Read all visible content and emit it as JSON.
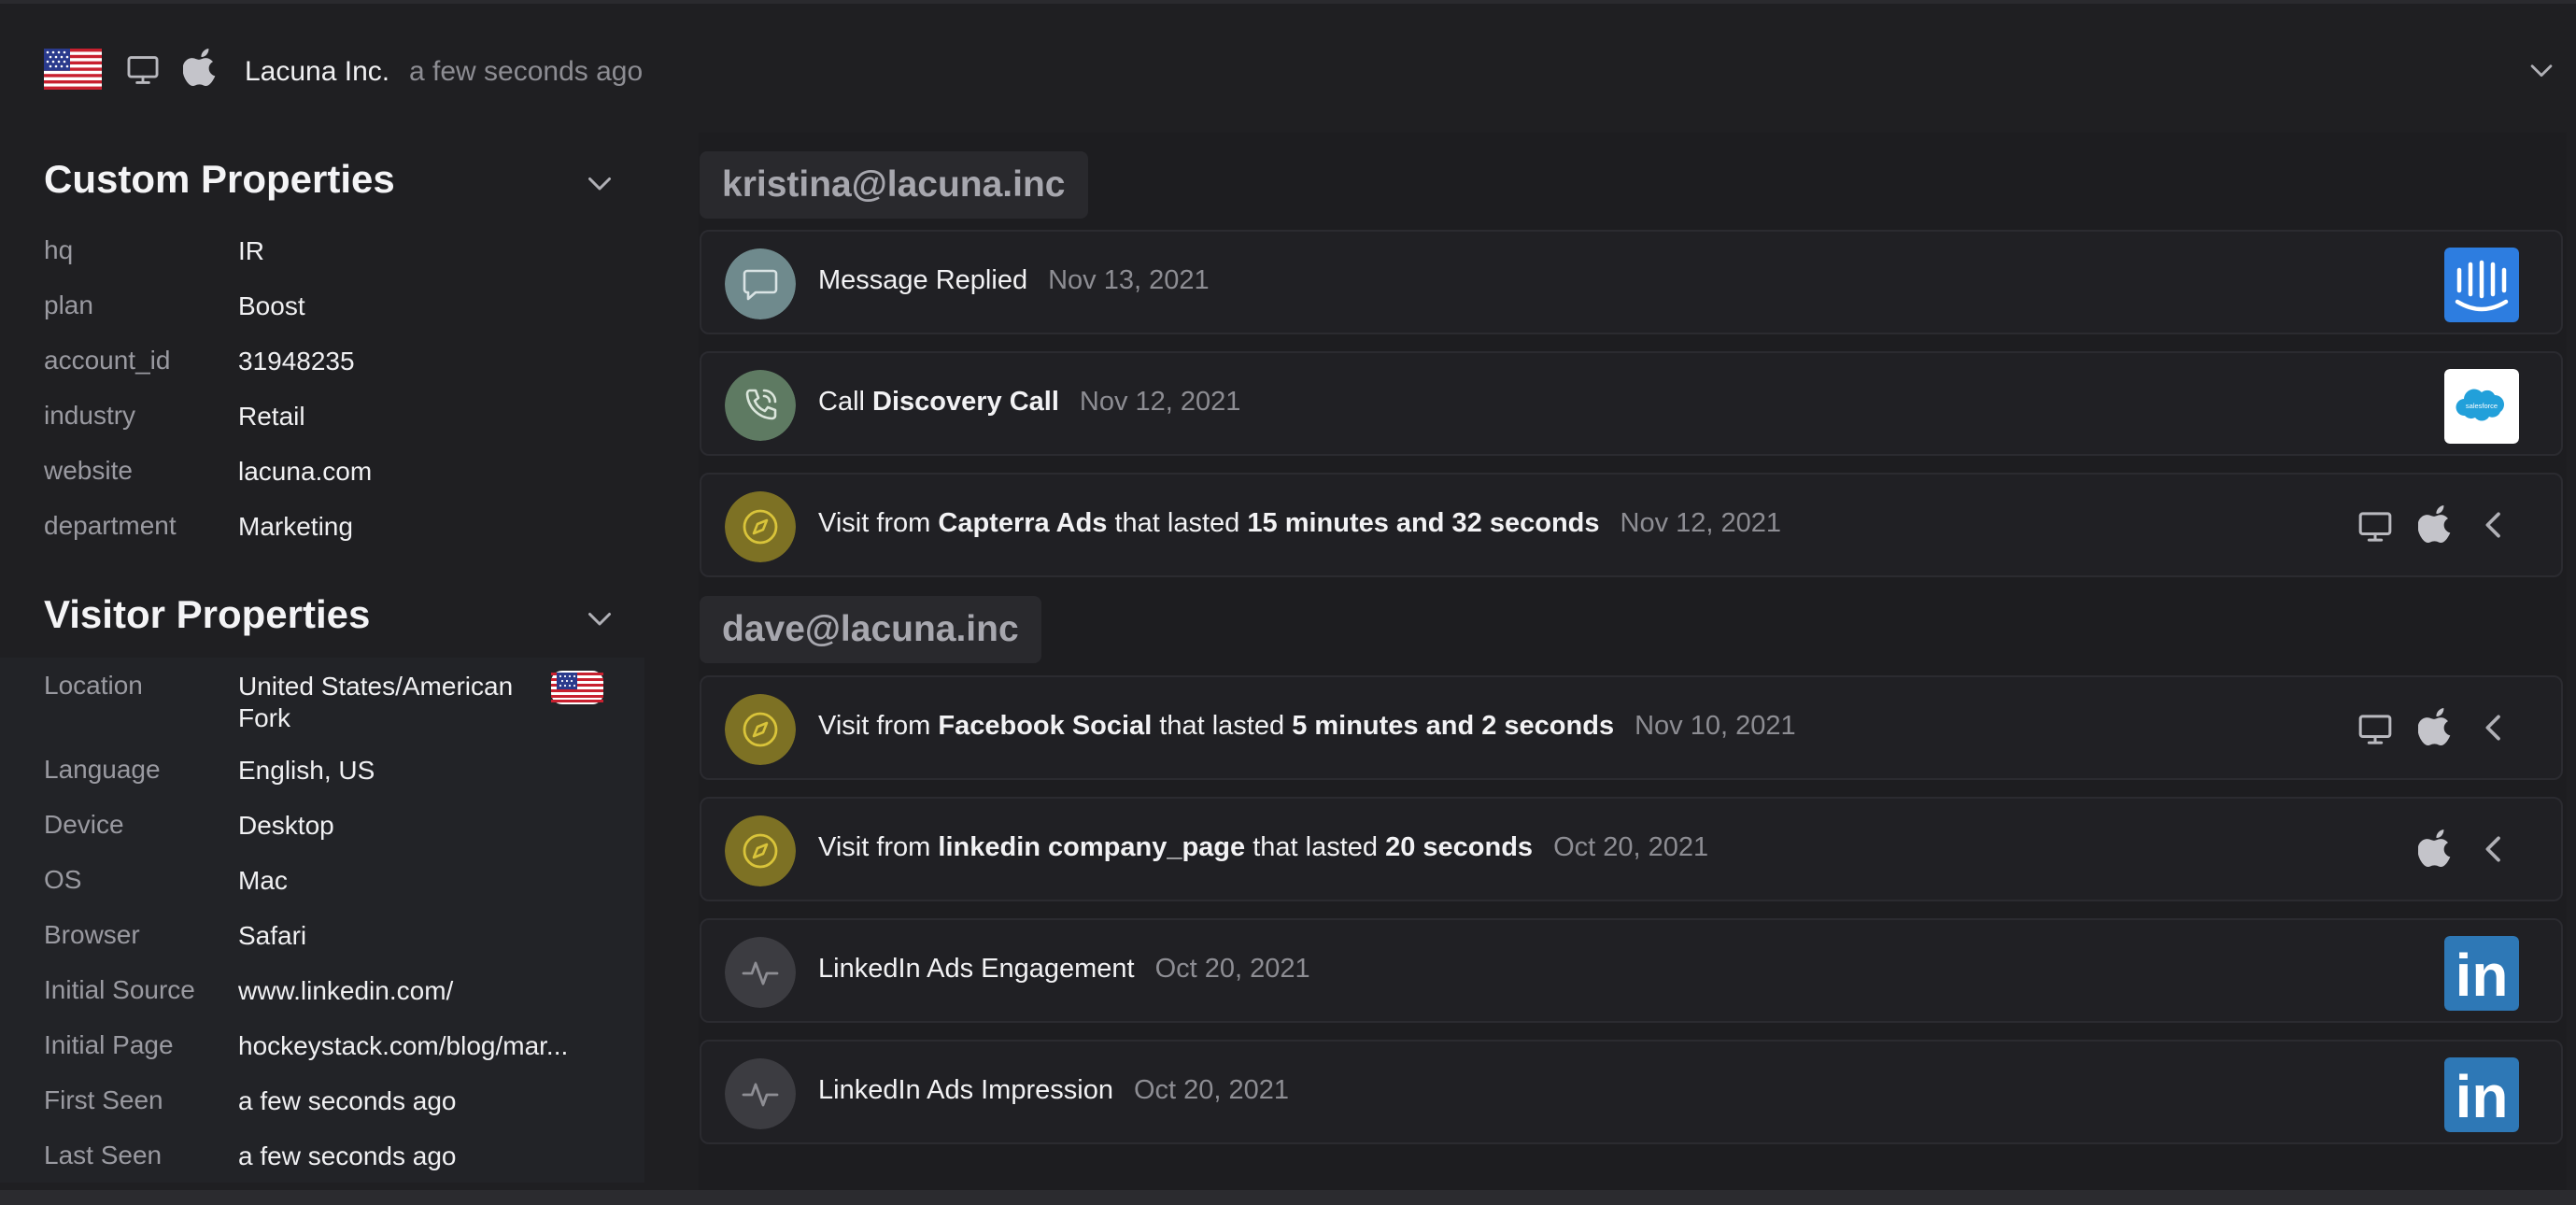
{
  "header": {
    "company": "Lacuna Inc.",
    "time": "a few seconds ago"
  },
  "custom_properties": {
    "title": "Custom Properties",
    "rows": [
      {
        "key": "hq",
        "value": "IR"
      },
      {
        "key": "plan",
        "value": "Boost"
      },
      {
        "key": "account_id",
        "value": "31948235"
      },
      {
        "key": "industry",
        "value": "Retail"
      },
      {
        "key": "website",
        "value": "lacuna.com"
      },
      {
        "key": "department",
        "value": "Marketing"
      }
    ]
  },
  "visitor_properties": {
    "title": "Visitor Properties",
    "location_key": "Location",
    "location_line1": "United States/American",
    "location_line2": "Fork",
    "rows": [
      {
        "key": "Language",
        "value": "English, US"
      },
      {
        "key": "Device",
        "value": "Desktop"
      },
      {
        "key": "OS",
        "value": "Mac"
      },
      {
        "key": "Browser",
        "value": "Safari"
      },
      {
        "key": "Initial Source",
        "value": "www.linkedin.com/"
      },
      {
        "key": "Initial Page",
        "value": "hockeystack.com/blog/mar..."
      },
      {
        "key": "First Seen",
        "value": "a few seconds ago"
      },
      {
        "key": "Last Seen",
        "value": "a few seconds ago"
      }
    ]
  },
  "timeline": {
    "groups": [
      {
        "email": "kristina@lacuna.inc",
        "events": [
          {
            "type": "message",
            "text": "Message Replied",
            "date": "Nov 13, 2021",
            "logo": "intercom"
          },
          {
            "type": "call",
            "prefix": "Call ",
            "bold": "Discovery Call",
            "date": "Nov 12, 2021",
            "logo": "salesforce"
          },
          {
            "type": "visit",
            "prefix": "Visit from ",
            "source": "Capterra Ads",
            "middle": " that lasted ",
            "duration": "15 minutes and 32 seconds",
            "date": "Nov 12, 2021"
          }
        ]
      },
      {
        "email": "dave@lacuna.inc",
        "events": [
          {
            "type": "visit",
            "prefix": "Visit from ",
            "source": "Facebook Social",
            "middle": " that lasted ",
            "duration": "5 minutes and 2 seconds",
            "date": "Nov 10, 2021"
          },
          {
            "type": "visit",
            "prefix": "Visit from ",
            "source": "linkedin company_page",
            "middle": " that lasted ",
            "duration": "20 seconds",
            "date": "Oct 20, 2021"
          },
          {
            "type": "activity",
            "text": "LinkedIn Ads Engagement",
            "date": "Oct 20, 2021",
            "logo": "linkedin"
          },
          {
            "type": "activity",
            "text": "LinkedIn Ads Impression",
            "date": "Oct 20, 2021",
            "logo": "linkedin"
          }
        ]
      }
    ]
  },
  "logos": {
    "salesforce_text": "salesforce",
    "linkedin_text": "in"
  },
  "colors": {
    "intercom": "#2d7de0",
    "linkedin": "#2e78b6",
    "salesforce_cloud": "#22a0da",
    "visit_icon": "#7d7124",
    "visit_icon_stroke": "#d9c43a",
    "message_icon": "#6f8a8d",
    "call_icon": "#5e7a62",
    "activity_icon": "#3c3c41"
  }
}
